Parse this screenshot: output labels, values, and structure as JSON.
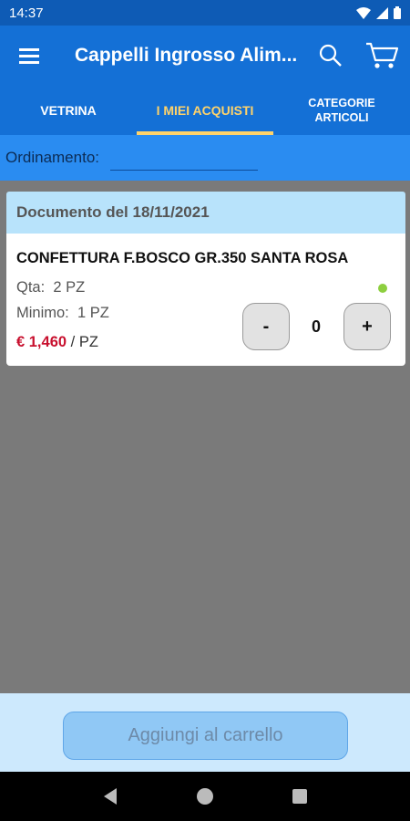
{
  "status_bar": {
    "time": "14:37"
  },
  "app_bar": {
    "title": "Cappelli Ingrosso Alim..."
  },
  "tabs": [
    {
      "label": "VETRINA"
    },
    {
      "label": "I MIEI ACQUISTI"
    },
    {
      "label_line1": "CATEGORIE",
      "label_line2": "ARTICOLI"
    }
  ],
  "sort": {
    "label": "Ordinamento:",
    "value": ""
  },
  "document": {
    "header": "Documento del 18/11/2021"
  },
  "product": {
    "name": "CONFETTURA F.BOSCO GR.350 SANTA ROSA",
    "qty_label": "Qta:",
    "qty_value": "2 PZ",
    "min_label": "Minimo:",
    "min_value": "1 PZ",
    "price": "€ 1,460",
    "unit": "/ PZ",
    "quantity": "0",
    "minus_label": "-",
    "plus_label": "+"
  },
  "bottom": {
    "add_button": "Aggiungi al carrello"
  },
  "colors": {
    "primary": "#1470d6",
    "accent": "#ffd36a",
    "price": "#c8102e"
  }
}
